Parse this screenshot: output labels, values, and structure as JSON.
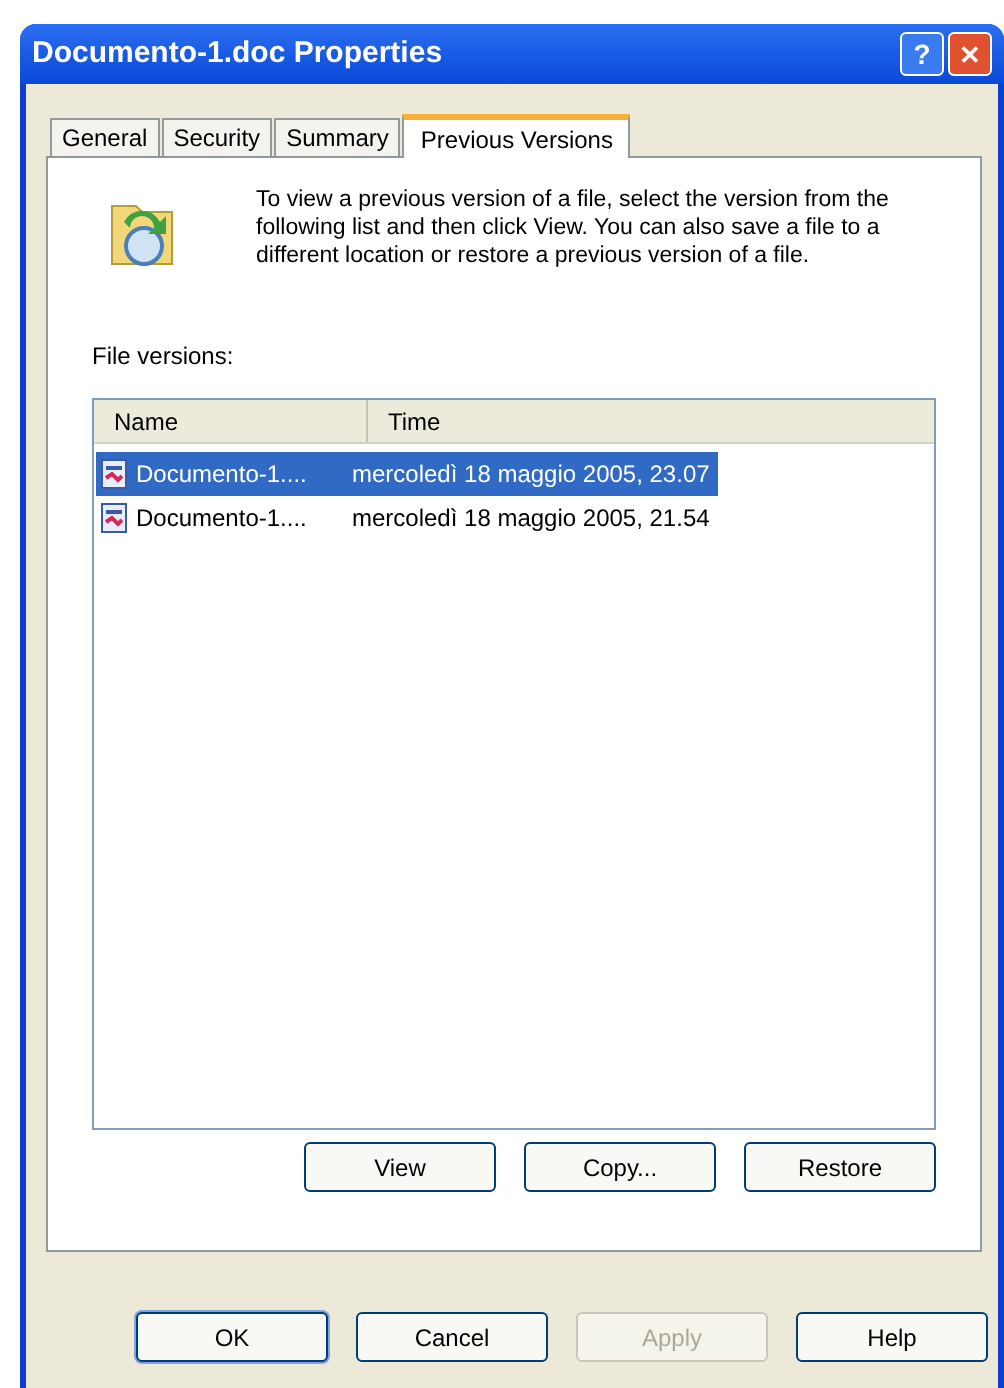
{
  "window": {
    "title": "Documento-1.doc Properties",
    "help_button": "?",
    "close_button": "✕"
  },
  "tabs": [
    {
      "label": "General",
      "selected": false
    },
    {
      "label": "Security",
      "selected": false
    },
    {
      "label": "Summary",
      "selected": false
    },
    {
      "label": "Previous Versions",
      "selected": true
    }
  ],
  "description": "To view a previous version of a file, select the version from the following list and then click View.  You can also save a file to a different location or restore a previous version of a file.",
  "list_label": "File versions:",
  "table": {
    "columns": [
      "Name",
      "Time"
    ],
    "rows": [
      {
        "name": "Documento-1....",
        "time": "mercoledì 18 maggio 2005, 23.07",
        "selected": true
      },
      {
        "name": "Documento-1....",
        "time": "mercoledì 18 maggio 2005, 21.54",
        "selected": false
      }
    ]
  },
  "panel_buttons": [
    {
      "label": "View",
      "disabled": false
    },
    {
      "label": "Copy...",
      "disabled": false
    },
    {
      "label": "Restore",
      "disabled": false
    }
  ],
  "dialog_buttons": [
    {
      "label": "OK",
      "disabled": false,
      "default": true
    },
    {
      "label": "Cancel",
      "disabled": false,
      "default": false
    },
    {
      "label": "Apply",
      "disabled": true,
      "default": false
    },
    {
      "label": "Help",
      "disabled": false,
      "default": false
    }
  ]
}
